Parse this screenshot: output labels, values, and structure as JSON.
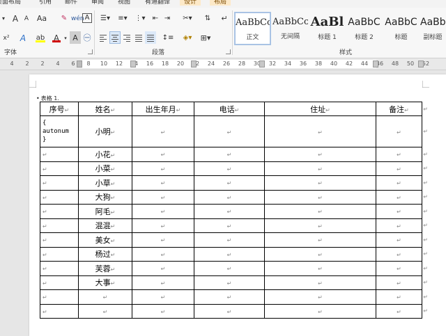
{
  "ribbon": {
    "tabs": [
      "页面布局",
      "引用",
      "邮件",
      "审阅",
      "视图",
      "有道翻译",
      "设计",
      "布局"
    ],
    "font_group_label": "字体",
    "paragraph_group_label": "段落",
    "styles_group_label": "样式",
    "styles": [
      {
        "sample": "AaBbCcI",
        "name": "正文",
        "selected": true
      },
      {
        "sample": "AaBbCcI",
        "name": "无间隔",
        "selected": false
      },
      {
        "sample": "AaBl",
        "name": "标题 1",
        "selected": false
      },
      {
        "sample": "AaBbC",
        "name": "标题 2",
        "selected": false
      },
      {
        "sample": "AaBbC",
        "name": "标题",
        "selected": false
      },
      {
        "sample": "AaBbC",
        "name": "副标题",
        "selected": false
      }
    ],
    "font_buttons": {
      "grow": "A",
      "shrink": "A",
      "case": "Aa",
      "superscript": "x²",
      "font_color": "A",
      "highlight": "ab",
      "char_border": "A",
      "phonetic": "wén",
      "char_shade": "A"
    },
    "accent_color": "#2b579a",
    "font_color": "#d00000",
    "highlight_color": "#ffff00"
  },
  "ruler": {
    "ticks": [
      "4",
      "2",
      "2",
      "4",
      "6",
      "8",
      "10",
      "12",
      "14",
      "16",
      "18",
      "20",
      "22",
      "24",
      "26",
      "28",
      "30",
      "32",
      "34",
      "36",
      "38",
      "40",
      "42",
      "44",
      "46",
      "48",
      "50",
      "52"
    ]
  },
  "document": {
    "caption_bullet": "•",
    "caption": "表格 1.",
    "cell_mark": "↵",
    "table": {
      "headers": [
        "序号",
        "姓名",
        "出生年月",
        "电话",
        "住址",
        "备注"
      ],
      "first_cell": [
        "{",
        "autonum",
        "}"
      ],
      "names": [
        "小明",
        "小花",
        "小菜",
        "小草",
        "大狗",
        "阿毛",
        "混混",
        "美女",
        "杨过",
        "芙蓉",
        "大事",
        "",
        ""
      ]
    }
  }
}
